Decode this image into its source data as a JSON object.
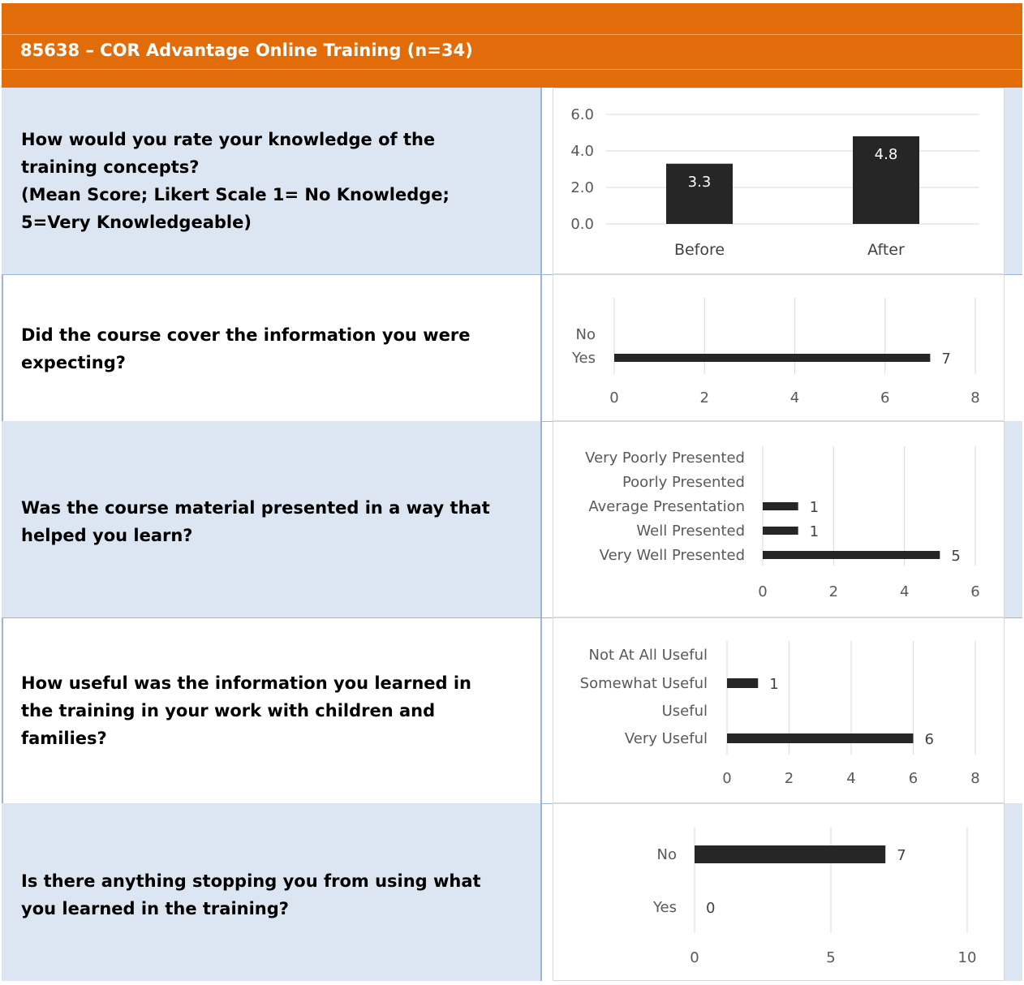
{
  "header": {
    "title": "85638 – COR Advantage Online Training (n=34)"
  },
  "questions": [
    {
      "text": "How would you rate your knowledge of the training concepts? (Mean Score; Likert Scale 1= No Knowledge; 5=Very Knowledgeable)",
      "lines": [
        "How would you rate your knowledge of the",
        "training concepts?",
        "(Mean Score; Likert Scale 1= No Knowledge;",
        "5=Very Knowledgeable)"
      ]
    },
    {
      "text": "Did the course cover the information you were expecting?",
      "lines": [
        "Did the course cover the information you were",
        "expecting?"
      ]
    },
    {
      "text": "Was the course material presented in a way that helped you learn?",
      "lines": [
        "Was the course material presented in a way that",
        "helped you learn?"
      ]
    },
    {
      "text": "How useful was the information you learned in the training in your work with children and families?",
      "lines": [
        "How useful was the information you learned in",
        "the training in your work with children and",
        "families?"
      ]
    },
    {
      "text": "Is there anything stopping you from using what you learned in the training?",
      "lines": [
        "Is there anything stopping you from using what",
        "you learned in the training?"
      ]
    }
  ],
  "colors": {
    "header": "#e36c0a",
    "shade": "#dce6f2",
    "bar": "#262626",
    "grid": "#d9d9d9"
  },
  "chart_data": [
    {
      "type": "bar",
      "orientation": "vertical",
      "categories": [
        "Before",
        "After"
      ],
      "values": [
        3.3,
        4.8
      ],
      "value_labels": [
        "3.3",
        "4.8"
      ],
      "ylim": [
        0,
        6
      ],
      "yticks": [
        "0.0",
        "2.0",
        "4.0",
        "6.0"
      ],
      "grid": true
    },
    {
      "type": "bar",
      "orientation": "horizontal",
      "categories": [
        "No",
        "Yes"
      ],
      "values": [
        null,
        7
      ],
      "value_labels": [
        "",
        "7"
      ],
      "xlim": [
        0,
        8
      ],
      "xticks": [
        "0",
        "2",
        "4",
        "6",
        "8"
      ],
      "grid": true
    },
    {
      "type": "bar",
      "orientation": "horizontal",
      "categories": [
        "Very Poorly Presented",
        "Poorly Presented",
        "Average Presentation",
        "Well Presented",
        "Very Well Presented"
      ],
      "values": [
        null,
        null,
        1,
        1,
        5
      ],
      "value_labels": [
        "",
        "",
        "1",
        "1",
        "5"
      ],
      "xlim": [
        0,
        6
      ],
      "xticks": [
        "0",
        "2",
        "4",
        "6"
      ],
      "grid": true
    },
    {
      "type": "bar",
      "orientation": "horizontal",
      "categories": [
        "Not At All Useful",
        "Somewhat Useful",
        "Useful",
        "Very Useful"
      ],
      "values": [
        null,
        1,
        null,
        6
      ],
      "value_labels": [
        "",
        "1",
        "",
        "6"
      ],
      "xlim": [
        0,
        8
      ],
      "xticks": [
        "0",
        "2",
        "4",
        "6",
        "8"
      ],
      "grid": true
    },
    {
      "type": "bar",
      "orientation": "horizontal",
      "categories": [
        "No",
        "Yes"
      ],
      "values": [
        7,
        0
      ],
      "value_labels": [
        "7",
        "0"
      ],
      "xlim": [
        0,
        10
      ],
      "xticks": [
        "0",
        "5",
        "10"
      ],
      "grid": true
    }
  ]
}
